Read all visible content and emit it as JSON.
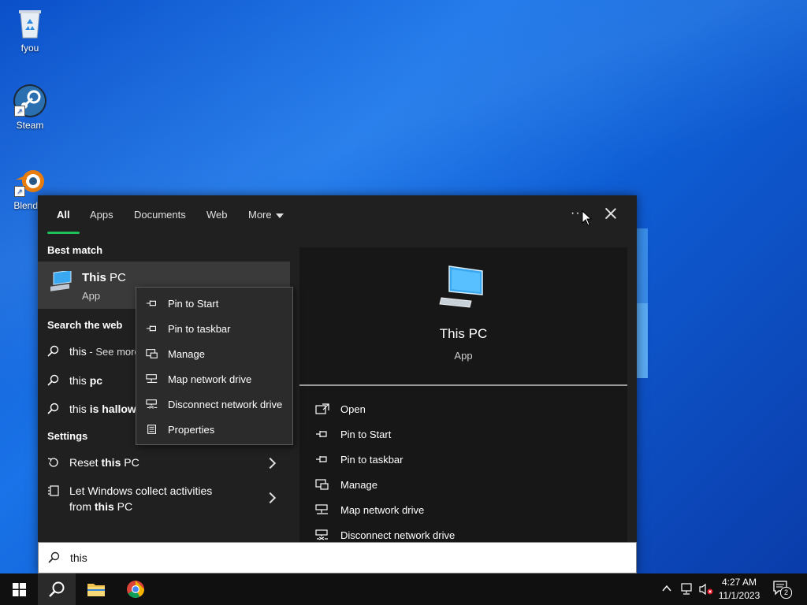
{
  "desktop": {
    "icons": [
      {
        "label": "fyou",
        "icon": "recycle-bin-icon"
      },
      {
        "label": "Steam",
        "icon": "steam-icon"
      },
      {
        "label": "Blender",
        "icon": "blender-icon"
      }
    ]
  },
  "search": {
    "tabs": [
      {
        "label": "All",
        "active": true
      },
      {
        "label": "Apps"
      },
      {
        "label": "Documents"
      },
      {
        "label": "Web"
      },
      {
        "label": "More"
      }
    ],
    "more_options": "···",
    "best_match_header": "Best match",
    "best_match": {
      "title_bold": "This",
      "title_rest": " PC",
      "subtitle": "App"
    },
    "web_header": "Search the web",
    "web_results": [
      {
        "prefix": "this",
        "suffix": " - See more search results"
      },
      {
        "prefix": "this ",
        "bold": "pc"
      },
      {
        "prefix": "this ",
        "bold": "is halloween"
      }
    ],
    "settings_header": "Settings",
    "settings_results": [
      {
        "pre": "Reset ",
        "bold": "this",
        "post": " PC"
      },
      {
        "line1": "Let Windows collect activities",
        "line2_pre": "from ",
        "line2_bold": "this",
        "line2_post": " PC"
      }
    ],
    "preview": {
      "title": "This PC",
      "subtitle": "App",
      "actions": [
        {
          "label": "Open",
          "icon": "open-icon"
        },
        {
          "label": "Pin to Start",
          "icon": "pin-icon"
        },
        {
          "label": "Pin to taskbar",
          "icon": "pin-icon"
        },
        {
          "label": "Manage",
          "icon": "manage-icon"
        },
        {
          "label": "Map network drive",
          "icon": "network-drive-icon"
        },
        {
          "label": "Disconnect network drive",
          "icon": "disconnect-drive-icon"
        }
      ]
    },
    "query": "this"
  },
  "context_menu": {
    "items": [
      {
        "label": "Pin to Start",
        "icon": "pin-icon"
      },
      {
        "label": "Pin to taskbar",
        "icon": "pin-icon"
      },
      {
        "label": "Manage",
        "icon": "manage-icon"
      },
      {
        "label": "Map network drive",
        "icon": "network-drive-icon"
      },
      {
        "label": "Disconnect network drive",
        "icon": "disconnect-drive-icon"
      },
      {
        "label": "Properties",
        "icon": "properties-icon"
      }
    ]
  },
  "taskbar": {
    "time": "4:27 AM",
    "date": "11/1/2023",
    "notification_count": "2"
  },
  "colors": {
    "accent_green": "#1ec15a",
    "panel_bg": "#202020",
    "taskbar_bg": "#101010"
  }
}
